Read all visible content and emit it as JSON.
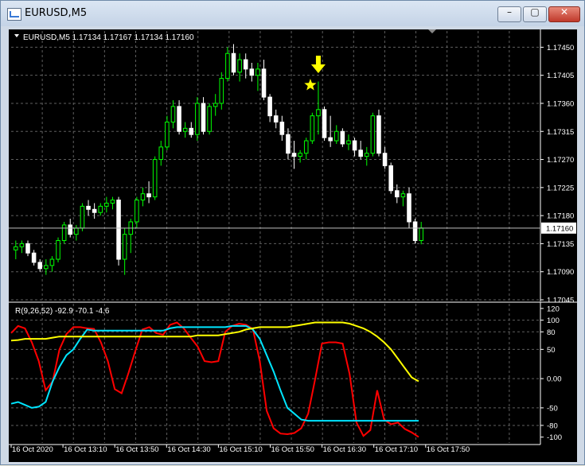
{
  "window": {
    "title": "EURUSD,M5",
    "minimize_label": "–",
    "maximize_label": "▢",
    "close_label": "✕"
  },
  "main_chart": {
    "header": "EURUSD,M5  1.17134 1.17167 1.17134 1.17160",
    "price_tag": "1.17160",
    "current_price": 1.1716,
    "ylim": [
      1.17045,
      1.17476
    ],
    "y_ticks": [
      "1.17450",
      "1.17405",
      "1.17360",
      "1.17315",
      "1.17270",
      "1.17225",
      "1.17180",
      "1.17135",
      "1.17090",
      "1.17045"
    ],
    "signal_arrow": "down-arrow-icon",
    "signal_star": "star-icon",
    "colors": {
      "bull": "#00ff00",
      "bear": "#ffffff",
      "grid": "#5f5f5f",
      "signal": "#ffff00",
      "background": "#000000"
    }
  },
  "indicator": {
    "label": "R(9,26,52) -92.9 -70.1 -4.6",
    "ylim": [
      -110,
      128
    ],
    "y_ticks": [
      "120",
      "100",
      "80",
      "50",
      "0.00",
      "-50",
      "-80",
      "-100"
    ],
    "colors": {
      "fast": "#ff0000",
      "mid": "#00e5ff",
      "slow": "#ffff00"
    }
  },
  "x_ticks": [
    "16 Oct 2020",
    "16 Oct 13:10",
    "16 Oct 13:50",
    "16 Oct 14:30",
    "16 Oct 15:10",
    "16 Oct 15:50",
    "16 Oct 16:30",
    "16 Oct 17:10",
    "16 Oct 17:50"
  ],
  "chart_data": [
    {
      "type": "candlestick",
      "title": "EURUSD,M5",
      "candles": [
        [
          1.17125,
          1.1714,
          1.1711,
          1.1713
        ],
        [
          1.1713,
          1.1714,
          1.1712,
          1.17135
        ],
        [
          1.17135,
          1.1714,
          1.17115,
          1.1712
        ],
        [
          1.1712,
          1.17125,
          1.171,
          1.17105
        ],
        [
          1.17105,
          1.1711,
          1.1709,
          1.17095
        ],
        [
          1.17095,
          1.1711,
          1.17085,
          1.171
        ],
        [
          1.171,
          1.17115,
          1.1709,
          1.1711
        ],
        [
          1.1711,
          1.17145,
          1.17105,
          1.1714
        ],
        [
          1.1714,
          1.1717,
          1.17135,
          1.17165
        ],
        [
          1.17165,
          1.17175,
          1.17145,
          1.1715
        ],
        [
          1.1715,
          1.17165,
          1.1714,
          1.1716
        ],
        [
          1.1716,
          1.172,
          1.17155,
          1.17195
        ],
        [
          1.17195,
          1.17205,
          1.1718,
          1.1719
        ],
        [
          1.1719,
          1.172,
          1.17175,
          1.17185
        ],
        [
          1.17185,
          1.172,
          1.1718,
          1.17195
        ],
        [
          1.17195,
          1.1721,
          1.17185,
          1.172
        ],
        [
          1.172,
          1.1721,
          1.1719,
          1.17205
        ],
        [
          1.17205,
          1.1721,
          1.171,
          1.1711
        ],
        [
          1.1711,
          1.1716,
          1.17085,
          1.1715
        ],
        [
          1.1715,
          1.17175,
          1.1712,
          1.1717
        ],
        [
          1.1717,
          1.1721,
          1.1716,
          1.17205
        ],
        [
          1.17205,
          1.17225,
          1.17195,
          1.17215
        ],
        [
          1.17215,
          1.17235,
          1.172,
          1.1721
        ],
        [
          1.1721,
          1.17275,
          1.17205,
          1.1727
        ],
        [
          1.1727,
          1.173,
          1.1726,
          1.1729
        ],
        [
          1.1729,
          1.1734,
          1.17285,
          1.1733
        ],
        [
          1.1733,
          1.17365,
          1.1732,
          1.17355
        ],
        [
          1.17355,
          1.17365,
          1.1731,
          1.17315
        ],
        [
          1.17315,
          1.1733,
          1.17305,
          1.1732
        ],
        [
          1.1732,
          1.1733,
          1.17305,
          1.1731
        ],
        [
          1.1731,
          1.1737,
          1.173,
          1.1736
        ],
        [
          1.1736,
          1.1737,
          1.1731,
          1.17315
        ],
        [
          1.17315,
          1.1736,
          1.1731,
          1.17355
        ],
        [
          1.17355,
          1.17375,
          1.1734,
          1.1736
        ],
        [
          1.1736,
          1.1741,
          1.1735,
          1.174
        ],
        [
          1.174,
          1.1745,
          1.17395,
          1.1744
        ],
        [
          1.1744,
          1.17455,
          1.17405,
          1.1741
        ],
        [
          1.1741,
          1.1744,
          1.17395,
          1.1743
        ],
        [
          1.1743,
          1.1744,
          1.174,
          1.17415
        ],
        [
          1.17415,
          1.17425,
          1.17395,
          1.17405
        ],
        [
          1.17405,
          1.17425,
          1.1738,
          1.17415
        ],
        [
          1.17415,
          1.1743,
          1.17365,
          1.1737
        ],
        [
          1.1737,
          1.17375,
          1.1733,
          1.1734
        ],
        [
          1.1734,
          1.1735,
          1.1732,
          1.1733
        ],
        [
          1.1733,
          1.1734,
          1.173,
          1.1731
        ],
        [
          1.1731,
          1.1732,
          1.1727,
          1.1728
        ],
        [
          1.1728,
          1.173,
          1.17255,
          1.17275
        ],
        [
          1.17275,
          1.17285,
          1.17265,
          1.1728
        ],
        [
          1.1728,
          1.17305,
          1.1727,
          1.173
        ],
        [
          1.173,
          1.17345,
          1.17295,
          1.1734
        ],
        [
          1.1734,
          1.17395,
          1.1731,
          1.1735
        ],
        [
          1.1735,
          1.17355,
          1.173,
          1.17305
        ],
        [
          1.17305,
          1.1734,
          1.1729,
          1.173
        ],
        [
          1.173,
          1.17325,
          1.17295,
          1.17315
        ],
        [
          1.17315,
          1.1732,
          1.1729,
          1.17295
        ],
        [
          1.17295,
          1.1731,
          1.17285,
          1.173
        ],
        [
          1.173,
          1.17305,
          1.17275,
          1.17285
        ],
        [
          1.17285,
          1.173,
          1.1727,
          1.17275
        ],
        [
          1.17275,
          1.1729,
          1.1726,
          1.1728
        ],
        [
          1.1728,
          1.17345,
          1.17275,
          1.1734
        ],
        [
          1.1734,
          1.1735,
          1.17275,
          1.1728
        ],
        [
          1.1728,
          1.1729,
          1.17255,
          1.1726
        ],
        [
          1.1726,
          1.17265,
          1.17215,
          1.1722
        ],
        [
          1.1722,
          1.1723,
          1.172,
          1.1721
        ],
        [
          1.1721,
          1.1722,
          1.17195,
          1.17215
        ],
        [
          1.17215,
          1.17225,
          1.1716,
          1.1717
        ],
        [
          1.1717,
          1.17175,
          1.17135,
          1.1714
        ],
        [
          1.1714,
          1.1717,
          1.17134,
          1.1716
        ]
      ],
      "ylim": [
        1.17045,
        1.17476
      ]
    },
    {
      "type": "line",
      "title": "R(9,26,52) -92.9 -70.1 -4.6",
      "ylim": [
        -110,
        128
      ],
      "series": [
        {
          "values": [
            78,
            90,
            86,
            62,
            30,
            -20,
            -5,
            50,
            76,
            88,
            88,
            86,
            85,
            62,
            30,
            -18,
            -25,
            10,
            48,
            84,
            88,
            78,
            75,
            92,
            96,
            86,
            70,
            55,
            30,
            28,
            30,
            80,
            90,
            94,
            92,
            85,
            30,
            -55,
            -85,
            -94,
            -95,
            -93,
            -85,
            -60,
            -2,
            60,
            62,
            62,
            60,
            8,
            -75,
            -98,
            -88,
            -20,
            -70,
            -78,
            -75,
            -86,
            -92,
            -100
          ]
        },
        {
          "values": [
            -43,
            -40,
            -45,
            -50,
            -48,
            -40,
            -5,
            20,
            40,
            50,
            68,
            84,
            82,
            82,
            82,
            82,
            82,
            82,
            82,
            82,
            82,
            82,
            82,
            86,
            88,
            88,
            88,
            88,
            88,
            88,
            88,
            88,
            90,
            90,
            90,
            84,
            68,
            40,
            12,
            -20,
            -50,
            -60,
            -70,
            -72,
            -72,
            -72,
            -72,
            -72,
            -72,
            -72,
            -72,
            -72,
            -72,
            -72,
            -72,
            -72,
            -72,
            -72,
            -72,
            -72
          ]
        },
        {
          "values": [
            65,
            66,
            68,
            68,
            68,
            68,
            70,
            72,
            72,
            72,
            72,
            72,
            72,
            72,
            72,
            72,
            72,
            72,
            72,
            72,
            72,
            72,
            72,
            72,
            72,
            72,
            72,
            74,
            74,
            74,
            74,
            76,
            78,
            80,
            84,
            86,
            88,
            88,
            88,
            88,
            88,
            90,
            92,
            94,
            96,
            96,
            96,
            96,
            96,
            94,
            90,
            86,
            80,
            72,
            62,
            50,
            34,
            18,
            2,
            -4.6
          ]
        }
      ]
    }
  ]
}
